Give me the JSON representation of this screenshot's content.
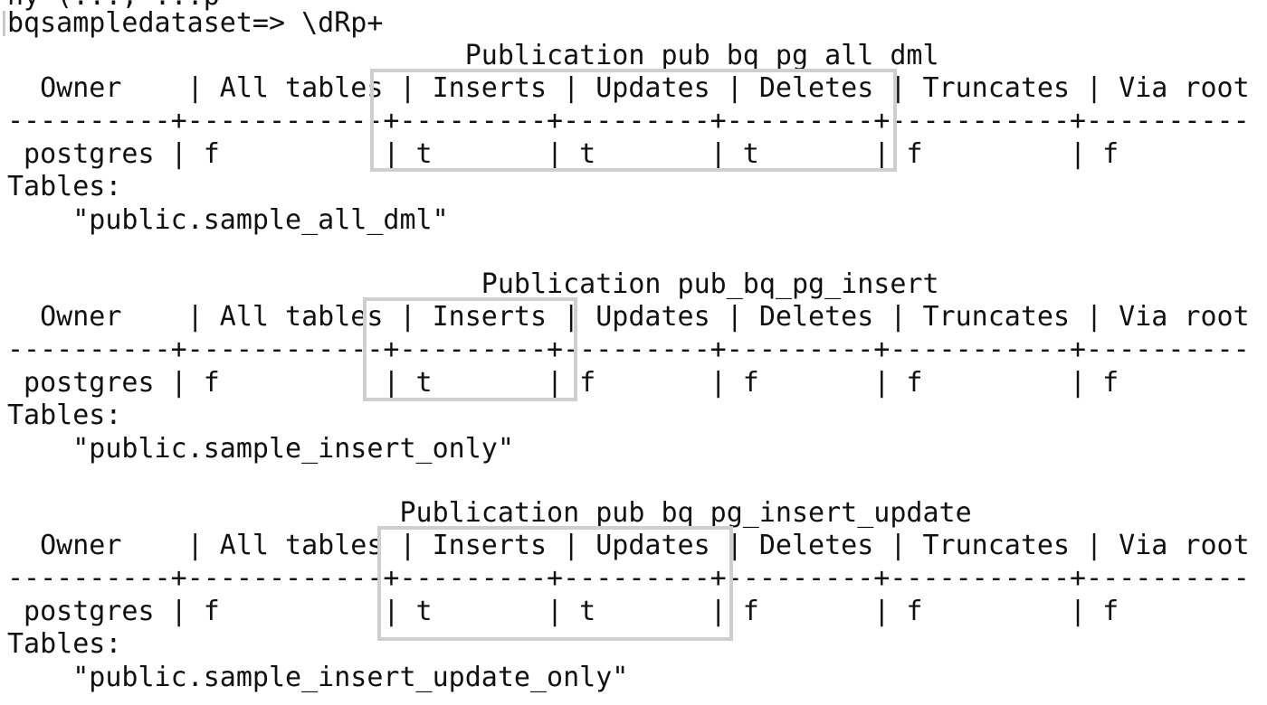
{
  "terminal": {
    "top_partial": "hy=(..., ...p",
    "command_line": "bqsampledataset=> \\dRp+",
    "publications": [
      {
        "title": "                            Publication pub_bq_pg_all_dml",
        "header": "  Owner    | All tables | Inserts | Updates | Deletes | Truncates | Via root",
        "separator": "----------+------------+---------+---------+---------+-----------+----------",
        "row": " postgres | f          | t       | t       | t       | f         | f",
        "tables_label": "Tables:",
        "table_name": "    \"public.sample_all_dml\"",
        "highlighted_columns": [
          "Inserts",
          "Updates",
          "Deletes"
        ]
      },
      {
        "title": "                             Publication pub_bq_pg_insert",
        "header": "  Owner    | All tables | Inserts | Updates | Deletes | Truncates | Via root",
        "separator": "----------+------------+---------+---------+---------+-----------+----------",
        "row": " postgres | f          | t       | f       | f       | f         | f",
        "tables_label": "Tables:",
        "table_name": "    \"public.sample_insert_only\"",
        "highlighted_columns": [
          "Inserts"
        ]
      },
      {
        "title": "                        Publication pub_bq_pg_insert_update",
        "header": "  Owner    | All tables | Inserts | Updates | Deletes | Truncates | Via root",
        "separator": "----------+------------+---------+---------+---------+-----------+----------",
        "row": " postgres | f          | t       | t       | f       | f         | f",
        "tables_label": "Tables:",
        "table_name": "    \"public.sample_insert_update_only\"",
        "highlighted_columns": [
          "Inserts",
          "Updates"
        ]
      }
    ]
  },
  "colors": {
    "background": "#ffffff",
    "text": "#111111",
    "highlight_box": "#cfcfcf"
  }
}
